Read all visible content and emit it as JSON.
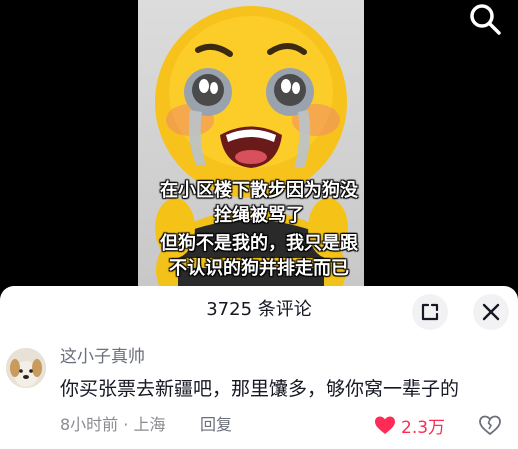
{
  "video": {
    "caption_lines": [
      "在小区楼下散步因为狗没",
      "拴绳被骂了",
      "但狗不是我的，我只是跟",
      "不认识的狗并排走而已"
    ],
    "search_icon": "search-icon"
  },
  "comments_panel": {
    "count_label": "3725 条评论",
    "expand_icon": "expand-icon",
    "close_icon": "close-icon"
  },
  "comment": {
    "username": "这小子真帅",
    "text": "你买张票去新疆吧，那里馕多，够你窝一辈子的",
    "meta": "8小时前 · 上海",
    "reply_label": "回复",
    "like_count": "2.3万",
    "like_color": "#fe2c55",
    "liked": true
  }
}
